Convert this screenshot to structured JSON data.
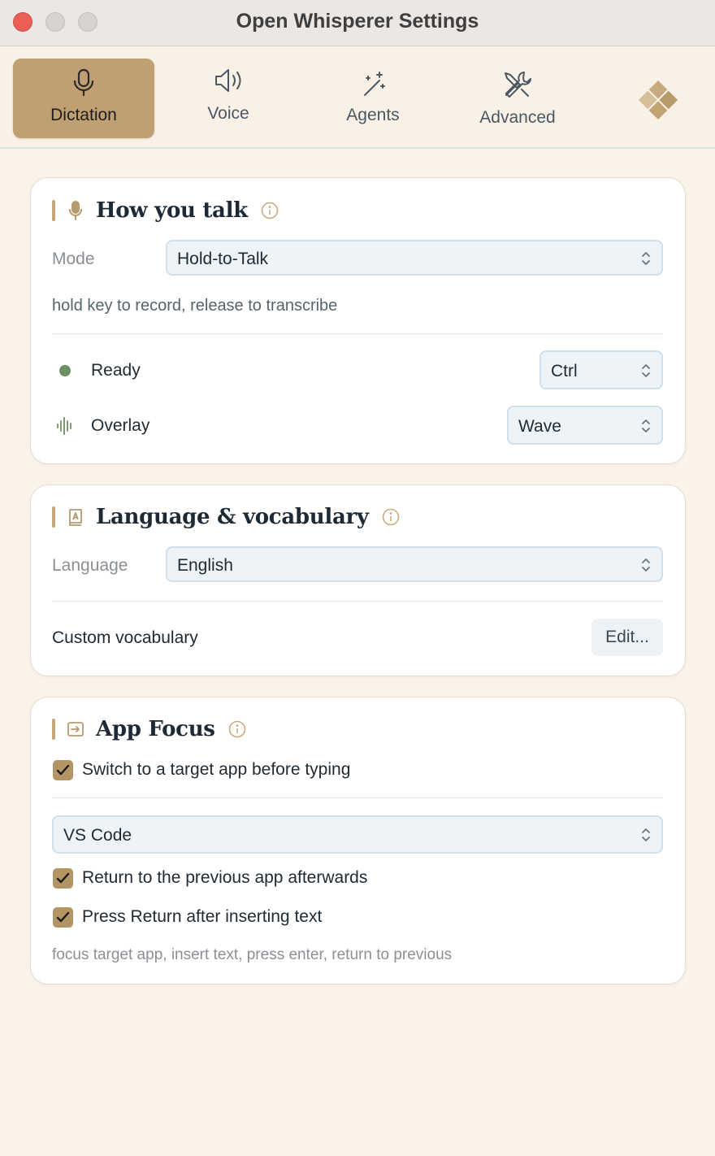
{
  "window": {
    "title": "Open Whisperer Settings"
  },
  "tabs": [
    {
      "label": "Dictation",
      "icon": "microphone-icon",
      "active": true
    },
    {
      "label": "Voice",
      "icon": "speaker-icon",
      "active": false
    },
    {
      "label": "Agents",
      "icon": "magic-wand-icon",
      "active": false
    },
    {
      "label": "Advanced",
      "icon": "tools-icon",
      "active": false
    }
  ],
  "how_you_talk": {
    "title": "How you talk",
    "mode_label": "Mode",
    "mode_value": "Hold-to-Talk",
    "mode_hint": "hold key to record, release to transcribe",
    "status_label": "Ready",
    "key_value": "Ctrl",
    "overlay_label": "Overlay",
    "overlay_value": "Wave"
  },
  "language": {
    "title": "Language & vocabulary",
    "language_label": "Language",
    "language_value": "English",
    "vocab_label": "Custom vocabulary",
    "edit_label": "Edit..."
  },
  "app_focus": {
    "title": "App Focus",
    "switch_label": "Switch to a target app before typing",
    "switch_checked": true,
    "target_app": "VS Code",
    "return_label": "Return to the previous app afterwards",
    "return_checked": true,
    "press_return_label": "Press Return after inserting text",
    "press_return_checked": true,
    "hint": "focus target app, insert text, press enter, return to previous"
  },
  "colors": {
    "accent": "#c0a072",
    "checkbox": "#b29465",
    "status_ready": "#6b8f5e",
    "background": "#faf3ea"
  }
}
